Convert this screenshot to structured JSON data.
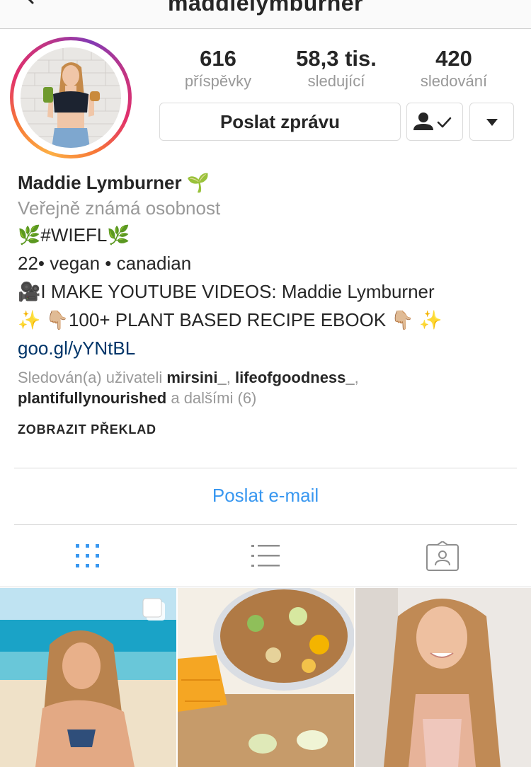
{
  "header": {
    "username": "maddielymburner"
  },
  "profile": {
    "stats": [
      {
        "value": "616",
        "label": "příspěvky"
      },
      {
        "value": "58,3 tis.",
        "label": "sledující"
      },
      {
        "value": "420",
        "label": "sledování"
      }
    ],
    "message_button": "Poslat zprávu"
  },
  "bio": {
    "name": "Maddie Lymburner 🌱",
    "category": "Veřejně známá osobnost",
    "lines": [
      "🌿#WIEFL🌿",
      "22• vegan • canadian",
      "🎥I MAKE YOUTUBE VIDEOS: Maddie Lymburner",
      "✨ 👇🏼100+ PLANT BASED RECIPE EBOOK 👇🏼 ✨"
    ],
    "link": "goo.gl/yYNtBL"
  },
  "followed_by": {
    "prefix": "Sledován(a) uživateli ",
    "users": [
      "mirsini_",
      "lifeofgoodness_",
      "plantifullynourished"
    ],
    "sep": ", ",
    "suffix": " a dalšími (6)"
  },
  "translate": "ZOBRAZIT PŘEKLAD",
  "email_button": "Poslat e-mail",
  "tabs": [
    "grid-icon",
    "list-icon",
    "tagged-icon"
  ],
  "colors": {
    "accent_blue": "#3897f0",
    "link_blue": "#003569",
    "secondary_text": "#999999"
  }
}
